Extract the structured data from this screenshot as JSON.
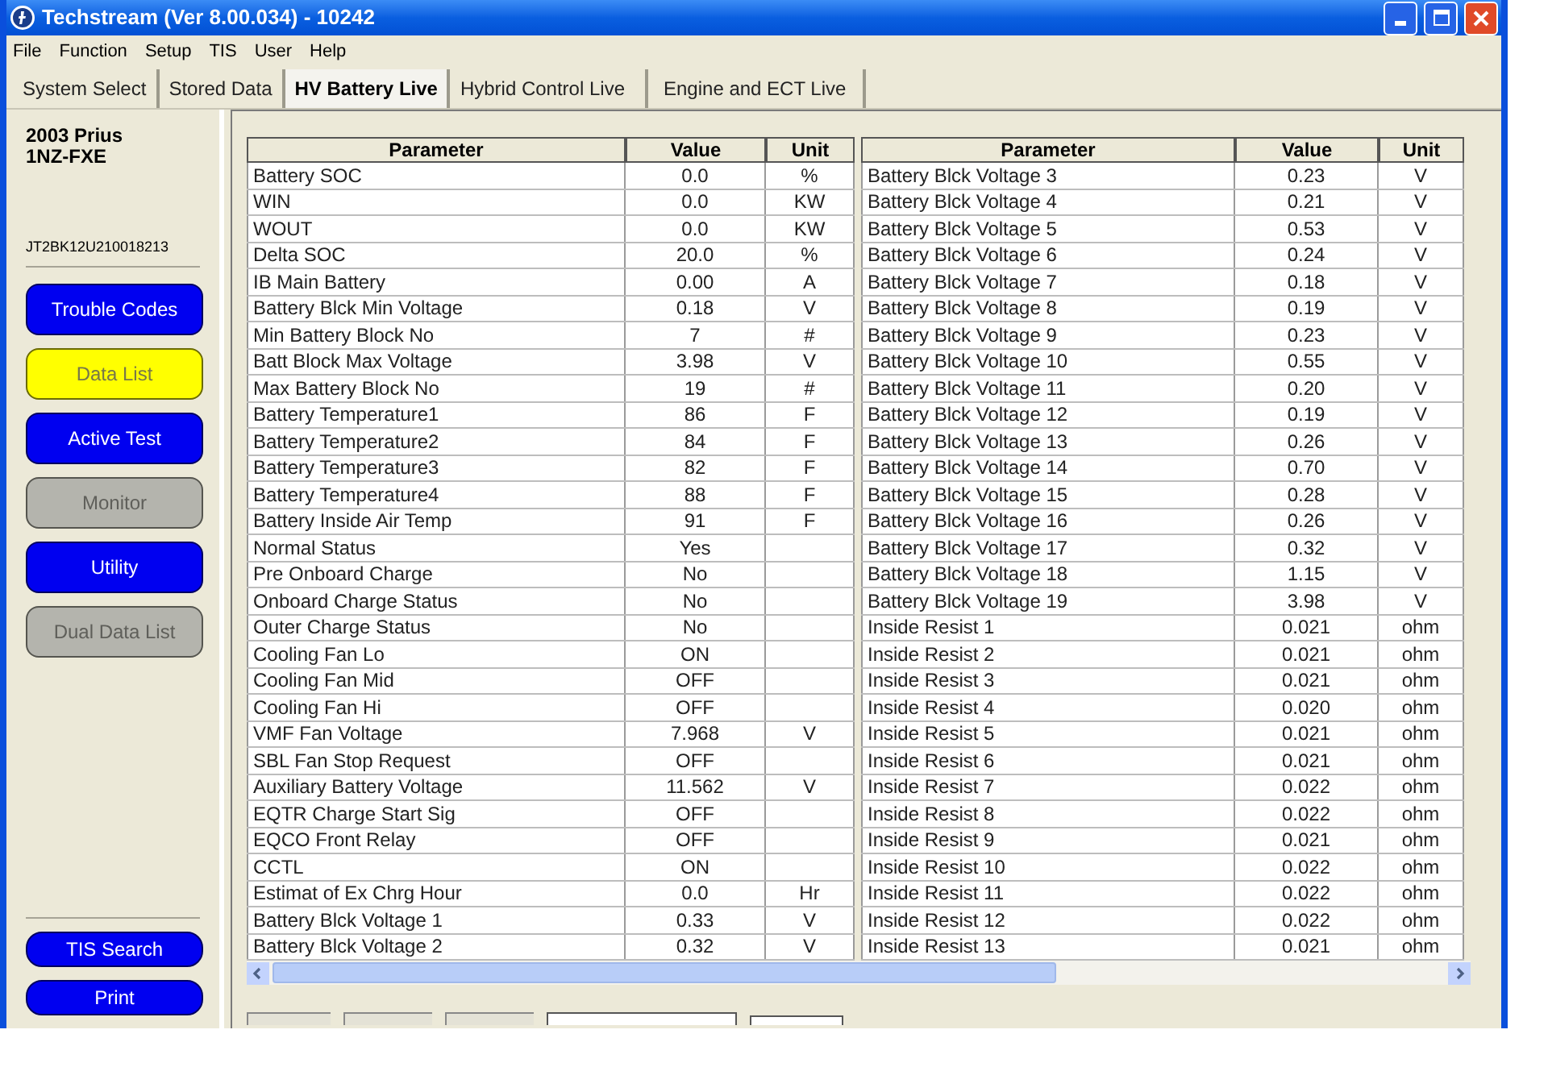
{
  "window": {
    "title": "Techstream (Ver 8.00.034) - 10242"
  },
  "menu": [
    "File",
    "Function",
    "Setup",
    "TIS",
    "User",
    "Help"
  ],
  "tabs": [
    {
      "label": "System Select",
      "selected": false
    },
    {
      "label": "Stored Data",
      "selected": false
    },
    {
      "label": "HV Battery Live",
      "selected": true
    },
    {
      "label": "Hybrid Control Live",
      "selected": false
    },
    {
      "label": "Engine and ECT Live",
      "selected": false
    }
  ],
  "sidebar": {
    "vehicle": "2003 Prius",
    "engine": "1NZ-FXE",
    "vin": "JT2BK12U210018213",
    "buttons": [
      {
        "label": "Trouble Codes",
        "kind": "enabled"
      },
      {
        "label": "Data List",
        "kind": "current"
      },
      {
        "label": "Active Test",
        "kind": "enabled"
      },
      {
        "label": "Monitor",
        "kind": "disabled"
      },
      {
        "label": "Utility",
        "kind": "enabled"
      },
      {
        "label": "Dual Data List",
        "kind": "disabled"
      }
    ],
    "bottom_buttons": [
      "TIS Search",
      "Print"
    ]
  },
  "tables": [
    {
      "columns": [
        "Parameter",
        "Value",
        "Unit"
      ],
      "rows": [
        [
          "Battery SOC",
          "0.0",
          "%"
        ],
        [
          "WIN",
          "0.0",
          "KW"
        ],
        [
          "WOUT",
          "0.0",
          "KW"
        ],
        [
          "Delta SOC",
          "20.0",
          "%"
        ],
        [
          "IB Main Battery",
          "0.00",
          "A"
        ],
        [
          "Battery Blck Min Voltage",
          "0.18",
          "V"
        ],
        [
          "Min Battery Block No",
          "7",
          "#"
        ],
        [
          "Batt Block Max Voltage",
          "3.98",
          "V"
        ],
        [
          "Max Battery Block No",
          "19",
          "#"
        ],
        [
          "Battery Temperature1",
          "86",
          "F"
        ],
        [
          "Battery Temperature2",
          "84",
          "F"
        ],
        [
          "Battery Temperature3",
          "82",
          "F"
        ],
        [
          "Battery Temperature4",
          "88",
          "F"
        ],
        [
          "Battery Inside Air Temp",
          "91",
          "F"
        ],
        [
          "Normal Status",
          "Yes",
          ""
        ],
        [
          "Pre Onboard Charge",
          "No",
          ""
        ],
        [
          "Onboard Charge Status",
          "No",
          ""
        ],
        [
          "Outer Charge Status",
          "No",
          ""
        ],
        [
          "Cooling Fan Lo",
          "ON",
          ""
        ],
        [
          "Cooling Fan Mid",
          "OFF",
          ""
        ],
        [
          "Cooling Fan Hi",
          "OFF",
          ""
        ],
        [
          "VMF Fan Voltage",
          "7.968",
          "V"
        ],
        [
          "SBL Fan Stop Request",
          "OFF",
          ""
        ],
        [
          "Auxiliary Battery Voltage",
          "11.562",
          "V"
        ],
        [
          "EQTR Charge Start Sig",
          "OFF",
          ""
        ],
        [
          "EQCO Front Relay",
          "OFF",
          ""
        ],
        [
          "CCTL",
          "ON",
          ""
        ],
        [
          "Estimat of Ex Chrg Hour",
          "0.0",
          "Hr"
        ],
        [
          "Battery Blck Voltage 1",
          "0.33",
          "V"
        ],
        [
          "Battery Blck Voltage 2",
          "0.32",
          "V"
        ]
      ]
    },
    {
      "columns": [
        "Parameter",
        "Value",
        "Unit"
      ],
      "rows": [
        [
          "Battery Blck Voltage 3",
          "0.23",
          "V"
        ],
        [
          "Battery Blck Voltage 4",
          "0.21",
          "V"
        ],
        [
          "Battery Blck Voltage 5",
          "0.53",
          "V"
        ],
        [
          "Battery Blck Voltage 6",
          "0.24",
          "V"
        ],
        [
          "Battery Blck Voltage 7",
          "0.18",
          "V"
        ],
        [
          "Battery Blck Voltage 8",
          "0.19",
          "V"
        ],
        [
          "Battery Blck Voltage 9",
          "0.23",
          "V"
        ],
        [
          "Battery Blck Voltage 10",
          "0.55",
          "V"
        ],
        [
          "Battery Blck Voltage 11",
          "0.20",
          "V"
        ],
        [
          "Battery Blck Voltage 12",
          "0.19",
          "V"
        ],
        [
          "Battery Blck Voltage 13",
          "0.26",
          "V"
        ],
        [
          "Battery Blck Voltage 14",
          "0.70",
          "V"
        ],
        [
          "Battery Blck Voltage 15",
          "0.28",
          "V"
        ],
        [
          "Battery Blck Voltage 16",
          "0.26",
          "V"
        ],
        [
          "Battery Blck Voltage 17",
          "0.32",
          "V"
        ],
        [
          "Battery Blck Voltage 18",
          "1.15",
          "V"
        ],
        [
          "Battery Blck Voltage 19",
          "3.98",
          "V"
        ],
        [
          "Inside Resist 1",
          "0.021",
          "ohm"
        ],
        [
          "Inside Resist 2",
          "0.021",
          "ohm"
        ],
        [
          "Inside Resist 3",
          "0.021",
          "ohm"
        ],
        [
          "Inside Resist 4",
          "0.020",
          "ohm"
        ],
        [
          "Inside Resist 5",
          "0.021",
          "ohm"
        ],
        [
          "Inside Resist 6",
          "0.021",
          "ohm"
        ],
        [
          "Inside Resist 7",
          "0.022",
          "ohm"
        ],
        [
          "Inside Resist 8",
          "0.022",
          "ohm"
        ],
        [
          "Inside Resist 9",
          "0.021",
          "ohm"
        ],
        [
          "Inside Resist 10",
          "0.022",
          "ohm"
        ],
        [
          "Inside Resist 11",
          "0.022",
          "ohm"
        ],
        [
          "Inside Resist 12",
          "0.022",
          "ohm"
        ],
        [
          "Inside Resist 13",
          "0.021",
          "ohm"
        ]
      ]
    }
  ]
}
